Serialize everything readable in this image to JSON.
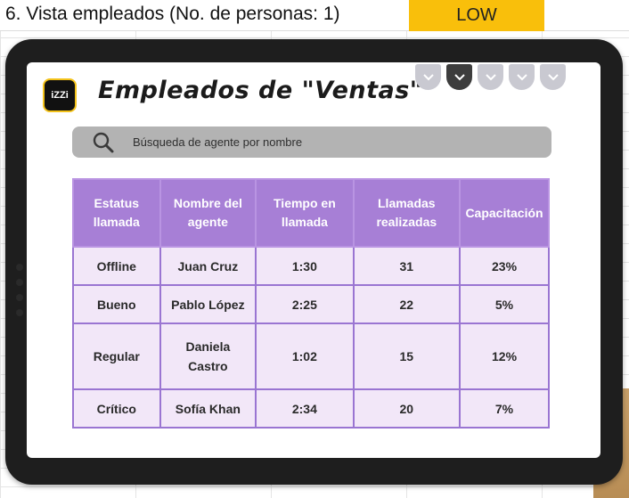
{
  "sheet": {
    "title": "6. Vista empleados (No. de personas: 1)",
    "priority": "LOW",
    "priority_color": "#f9bf0b"
  },
  "app": {
    "logo_text": "iZZi",
    "title": "Empleados de \"Ventas\"",
    "tabs": [
      {
        "icon": "chevron-down-icon",
        "active": false
      },
      {
        "icon": "chevron-down-icon",
        "active": true
      },
      {
        "icon": "chevron-down-icon",
        "active": false
      },
      {
        "icon": "chevron-down-icon",
        "active": false
      },
      {
        "icon": "chevron-down-icon",
        "active": false
      }
    ],
    "search": {
      "placeholder": "Búsqueda de agente por nombre",
      "icon": "search-icon"
    }
  },
  "table": {
    "headers": [
      "Estatus llamada",
      "Nombre del agente",
      "Tiempo en llamada",
      "Llamadas realizadas",
      "Capacitación"
    ],
    "rows": [
      {
        "status": "Offline",
        "name": "Juan Cruz",
        "time": "1:30",
        "calls": "31",
        "training": "23%"
      },
      {
        "status": "Bueno",
        "name": "Pablo López",
        "time": "2:25",
        "calls": "22",
        "training": "5%"
      },
      {
        "status": "Regular",
        "name": "Daniela Castro",
        "time": "1:02",
        "calls": "15",
        "training": "12%"
      },
      {
        "status": "Crítico",
        "name": "Sofía Khan",
        "time": "2:34",
        "calls": "20",
        "training": "7%"
      }
    ],
    "header_color": "#a77fd6",
    "cell_color": "#f2e7f8"
  }
}
